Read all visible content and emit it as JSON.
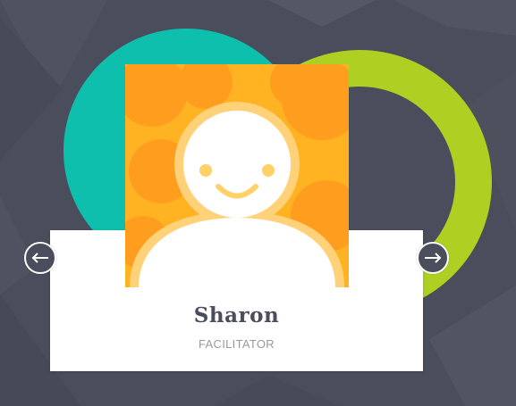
{
  "member": {
    "name": "Sharon",
    "role": "FACILITATOR"
  },
  "navigation": {
    "prev_icon": "arrow-left-icon",
    "next_icon": "arrow-right-icon"
  },
  "colors": {
    "background": "#4a4d5b",
    "teal": "#0dbfac",
    "lime": "#aed022",
    "avatar_orange": "#ffa41f",
    "avatar_face_accent": "#ffd166",
    "card": "#ffffff",
    "name_text": "#4a4d5b",
    "role_text": "#979aa5"
  }
}
